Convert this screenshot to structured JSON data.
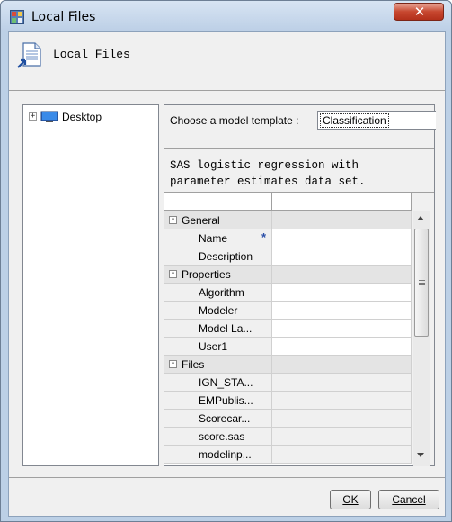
{
  "window": {
    "title": "Local Files",
    "close_glyph": "✕"
  },
  "header": {
    "title": "Local Files",
    "icon": "document-icon"
  },
  "tree": {
    "expander": "+",
    "items": [
      {
        "label": "Desktop",
        "icon": "desktop-icon"
      }
    ]
  },
  "template": {
    "label": "Choose a model template :",
    "selected": "Classification",
    "description": "SAS logistic regression with\nparameter estimates data set."
  },
  "grid": {
    "required_marker": "*",
    "groups": [
      {
        "label": "General",
        "toggle": "-",
        "fields": [
          "Name",
          "Description"
        ]
      },
      {
        "label": "Properties",
        "toggle": "-",
        "fields": [
          "Algorithm",
          "Modeler",
          "Model La...",
          "User1"
        ]
      },
      {
        "label": "Files",
        "toggle": "-",
        "fields": [
          "IGN_STA...",
          "EMPublis...",
          "Scorecar...",
          "score.sas",
          "modelinp..."
        ]
      }
    ]
  },
  "buttons": {
    "ok": "OK",
    "cancel": "Cancel"
  },
  "colors": {
    "accent": "#2b4fa8",
    "title_bar": "#bccfe6",
    "close": "#c7472f"
  }
}
